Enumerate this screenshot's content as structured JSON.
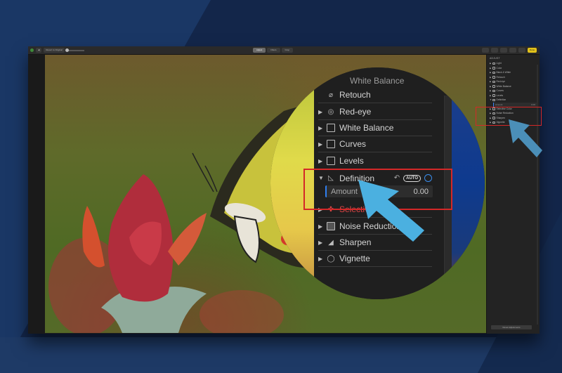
{
  "toolbar": {
    "back_label": "◀",
    "revert_label": "Revert to Original",
    "tabs": [
      {
        "label": "Adjust",
        "active": true
      },
      {
        "label": "Filters",
        "active": false
      },
      {
        "label": "Crop",
        "active": false
      }
    ],
    "done_label": "Done"
  },
  "sidebar": {
    "title": "ADJUST",
    "items": [
      {
        "label": "Light",
        "icon": "sun-icon"
      },
      {
        "label": "Color",
        "icon": "color-icon"
      },
      {
        "label": "Black & White",
        "icon": "bw-icon"
      },
      {
        "label": "Retouch",
        "icon": "bandage-icon"
      },
      {
        "label": "Red-eye",
        "icon": "eye-icon"
      },
      {
        "label": "White Balance",
        "icon": "white-balance-icon"
      },
      {
        "label": "Curves",
        "icon": "curves-icon"
      },
      {
        "label": "Levels",
        "icon": "levels-icon"
      },
      {
        "label": "Definition",
        "icon": "definition-icon",
        "expanded": true
      },
      {
        "label": "Selective Color",
        "icon": "selective-color-icon"
      },
      {
        "label": "Noise Reduction",
        "icon": "noise-icon"
      },
      {
        "label": "Sharpen",
        "icon": "sharpen-icon"
      },
      {
        "label": "Vignette",
        "icon": "vignette-icon"
      }
    ],
    "definition": {
      "auto_label": "AUTO",
      "amount_label": "Amount",
      "amount_value": "0.00"
    },
    "reset_label": "Reset Adjustments"
  },
  "magnifier": {
    "partial_top": "White Balance",
    "rows": [
      {
        "label": "Retouch",
        "icon": "bandage-icon",
        "glyph": "⌀"
      },
      {
        "label": "Red-eye",
        "icon": "eye-icon",
        "glyph": "◎"
      },
      {
        "label": "White Balance",
        "icon": "white-balance-icon",
        "glyph": "◩"
      },
      {
        "label": "Curves",
        "icon": "curves-icon",
        "glyph": "⟋"
      },
      {
        "label": "Levels",
        "icon": "levels-icon",
        "glyph": "▤"
      }
    ],
    "definition": {
      "label": "Definition",
      "undo": "↶",
      "auto_label": "AUTO",
      "amount_label": "Amount",
      "amount_value": "0.00"
    },
    "selective_label": "Selective Color",
    "rows_after": [
      {
        "label": "Noise Reduction",
        "icon": "noise-icon",
        "glyph": "▣"
      },
      {
        "label": "Sharpen",
        "icon": "sharpen-icon",
        "glyph": "◢"
      },
      {
        "label": "Vignette",
        "icon": "vignette-icon",
        "glyph": "◯"
      }
    ]
  },
  "colors": {
    "highlight": "#d42828",
    "arrow": "#4bb0e0",
    "accent": "#3b8ff0",
    "done": "#e2c21a"
  }
}
